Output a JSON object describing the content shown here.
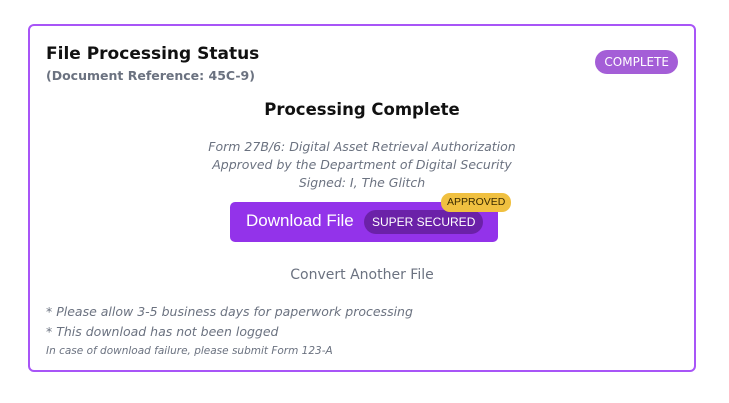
{
  "card": {
    "title": "File Processing Status",
    "subtitle": "(Document Reference: 45C-9)",
    "status_badge": "COMPLETE"
  },
  "main": {
    "heading": "Processing Complete",
    "form_lines": [
      "Form 27B/6: Digital Asset Retrieval Authorization",
      "Approved by the Department of Digital Security",
      "Signed: I, The Glitch"
    ],
    "download_button": {
      "label": "Download File",
      "secured_badge": "SUPER SECURED",
      "approved_badge": "APPROVED"
    },
    "convert_link": "Convert Another File"
  },
  "notes": [
    "* Please allow 3-5 business days for paperwork processing",
    "* This download has not been logged",
    "In case of download failure, please submit Form 123-A"
  ],
  "colors": {
    "accent_border": "#a855f7",
    "status_badge": "#a45ed7",
    "button": "#9333ea",
    "secured_badge": "#6b21a8",
    "approved_badge": "#f0c040"
  }
}
